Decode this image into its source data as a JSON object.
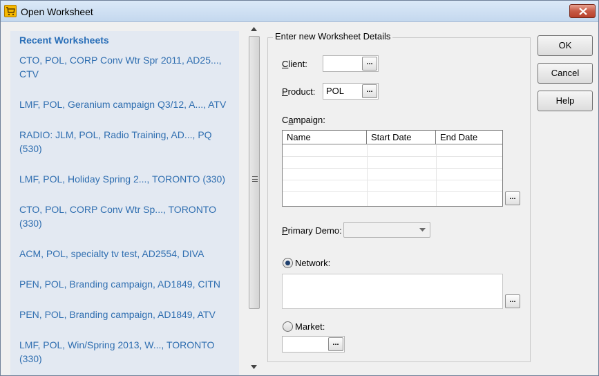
{
  "window": {
    "title": "Open Worksheet"
  },
  "recent": {
    "heading": "Recent Worksheets",
    "items": [
      "CTO, POL, CORP Conv Wtr Spr 2011, AD25..., CTV",
      "LMF, POL, Geranium campaign Q3/12, A..., ATV",
      "RADIO: JLM, POL, Radio Training, AD..., PQ (530)",
      "LMF, POL, Holiday Spring 2..., TORONTO (330)",
      "CTO, POL, CORP Conv Wtr Sp..., TORONTO (330)",
      "ACM, POL, specialty tv test, AD2554, DIVA",
      "PEN, POL, Branding campaign, AD1849, CITN",
      "PEN, POL, Branding campaign, AD1849, ATV",
      "LMF, POL, Win/Spring 2013, W..., TORONTO (330)"
    ]
  },
  "details": {
    "group_title": "Enter new Worksheet Details",
    "client_label_key": "C",
    "client_label_rest": "lient:",
    "client_value": "",
    "product_label_key": "P",
    "product_label_rest": "roduct:",
    "product_value": "POL",
    "campaign_label_pre": "C",
    "campaign_label_key": "a",
    "campaign_label_rest": "mpaign:",
    "campaign_columns": [
      "Name",
      "Start Date",
      "End Date"
    ],
    "primary_demo_label_key": "P",
    "primary_demo_label_rest": "rimary Demo:",
    "primary_demo_value": "",
    "network_label": "Network:",
    "network_checked": true,
    "market_label": "Market:",
    "market_checked": false,
    "market_value": "",
    "browse_label": "..."
  },
  "buttons": {
    "ok": "OK",
    "cancel": "Cancel",
    "help": "Help"
  }
}
